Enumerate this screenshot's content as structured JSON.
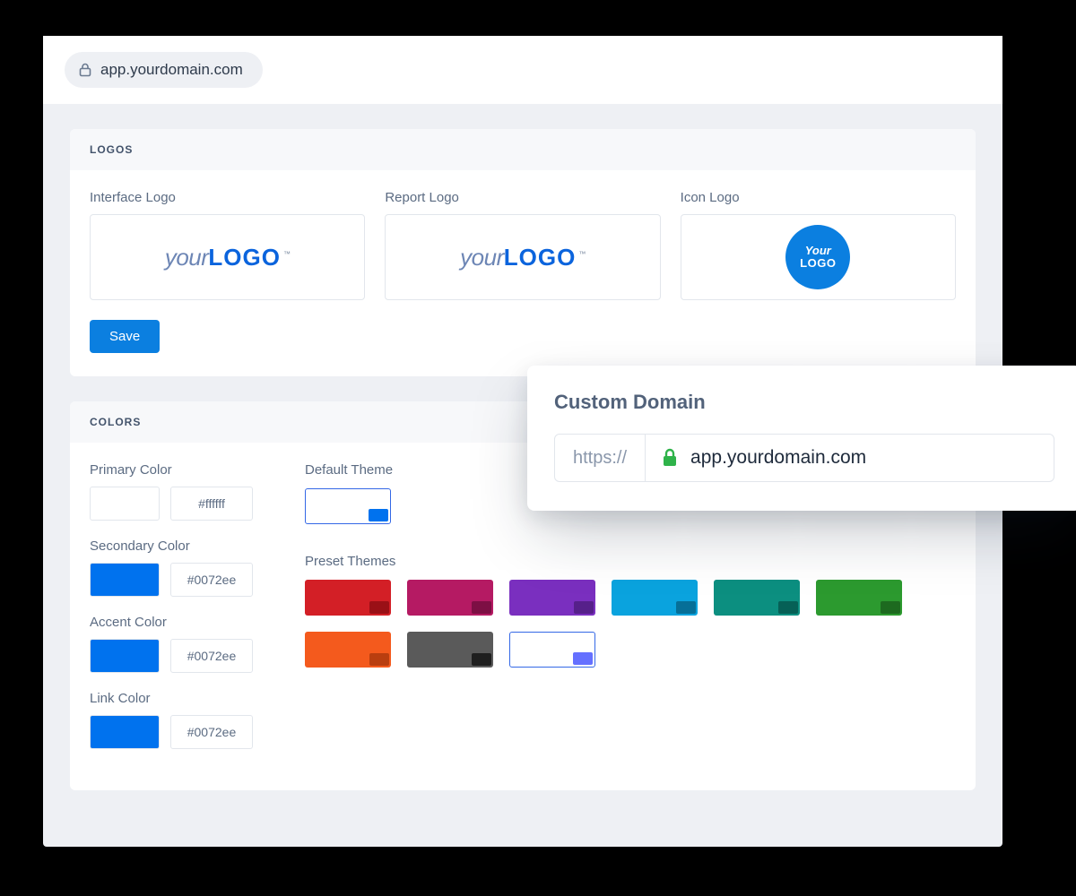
{
  "topbar": {
    "url": "app.yourdomain.com"
  },
  "logos": {
    "section_title": "LOGOS",
    "interface_label": "Interface Logo",
    "report_label": "Report Logo",
    "icon_label": "Icon Logo",
    "placeholder_prefix": "your",
    "placeholder_bold": "LOGO",
    "placeholder_tm": "™",
    "icon_circle_line1": "Your",
    "icon_circle_line2": "LOGO",
    "save_label": "Save"
  },
  "colors": {
    "section_title": "COLORS",
    "primary": {
      "label": "Primary Color",
      "hex": "#ffffff",
      "swatch": "#ffffff"
    },
    "secondary": {
      "label": "Secondary Color",
      "hex": "#0072ee",
      "swatch": "#0072ee"
    },
    "accent": {
      "label": "Accent Color",
      "hex": "#0072ee",
      "swatch": "#0072ee"
    },
    "link": {
      "label": "Link Color",
      "hex": "#0072ee",
      "swatch": "#0072ee"
    },
    "default_theme_label": "Default Theme",
    "default_theme": {
      "bg": "#ffffff",
      "chip": "#0072ee",
      "outlined": true
    },
    "preset_label": "Preset Themes",
    "presets": [
      {
        "bg": "#d31f26",
        "chip": "#9a1016"
      },
      {
        "bg": "#b51a63",
        "chip": "#7d0f44"
      },
      {
        "bg": "#7a2fbf",
        "chip": "#56208a"
      },
      {
        "bg": "#0aa3de",
        "chip": "#066f98"
      },
      {
        "bg": "#0c8f80",
        "chip": "#066056"
      },
      {
        "bg": "#2c9a2f",
        "chip": "#1d6a1f"
      },
      {
        "bg": "#f45a1d",
        "chip": "#b93e0f"
      },
      {
        "bg": "#5a5a5a",
        "chip": "#1f1f1f"
      },
      {
        "bg": "#ffffff",
        "chip": "#6570ff",
        "outlined": true
      }
    ]
  },
  "popover": {
    "title": "Custom Domain",
    "protocol": "https://",
    "domain": "app.yourdomain.com"
  },
  "palette": {
    "primary_blue": "#0b7fe0"
  }
}
